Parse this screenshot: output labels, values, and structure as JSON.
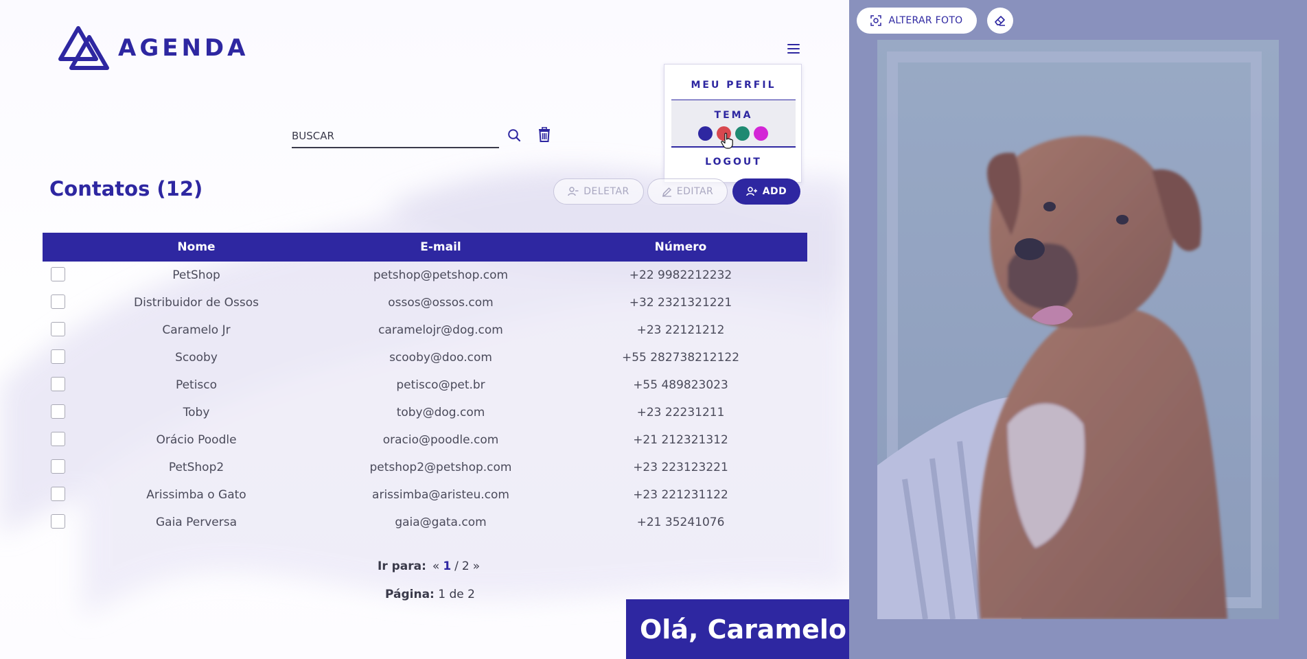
{
  "brand": {
    "name": "AGENDA",
    "color": "#2e27a1"
  },
  "menu": {
    "profile_label": "MEU PERFIL",
    "theme_label": "TEMA",
    "logout_label": "LOGOUT",
    "theme_colors": [
      "#2e27a1",
      "#d8484f",
      "#1f8a72",
      "#d326d6"
    ]
  },
  "search": {
    "placeholder": "BUSCAR"
  },
  "contacts": {
    "title": "Contatos (12)",
    "actions": {
      "delete_label": "DELETAR",
      "edit_label": "EDITAR",
      "add_label": "ADD"
    },
    "columns": [
      "Nome",
      "E-mail",
      "Número"
    ],
    "rows": [
      {
        "name": "PetShop",
        "email": "petshop@petshop.com",
        "phone": "+22 9982212232"
      },
      {
        "name": "Distribuidor de Ossos",
        "email": "ossos@ossos.com",
        "phone": "+32 2321321221"
      },
      {
        "name": "Caramelo Jr",
        "email": "caramelojr@dog.com",
        "phone": "+23 22121212"
      },
      {
        "name": "Scooby",
        "email": "scooby@doo.com",
        "phone": "+55 282738212122"
      },
      {
        "name": "Petisco",
        "email": "petisco@pet.br",
        "phone": "+55 489823023"
      },
      {
        "name": "Toby",
        "email": "toby@dog.com",
        "phone": "+23 22231211"
      },
      {
        "name": "Orácio Poodle",
        "email": "oracio@poodle.com",
        "phone": "+21 212321312"
      },
      {
        "name": "PetShop2",
        "email": "petshop2@petshop.com",
        "phone": "+23 223123221"
      },
      {
        "name": "Arissimba o Gato",
        "email": "arissimba@aristeu.com",
        "phone": "+23 221231122"
      },
      {
        "name": "Gaia Perversa",
        "email": "gaia@gata.com",
        "phone": "+21 35241076"
      }
    ]
  },
  "pagination": {
    "goto_label": "Ir para:",
    "prev": "«",
    "current": "1",
    "sep": "/",
    "total": "2",
    "next": "»",
    "page_label": "Página:",
    "page_value": "1 de 2"
  },
  "greeting": "Olá, Caramelo",
  "profile_photo": {
    "change_label": "ALTERAR FOTO"
  }
}
